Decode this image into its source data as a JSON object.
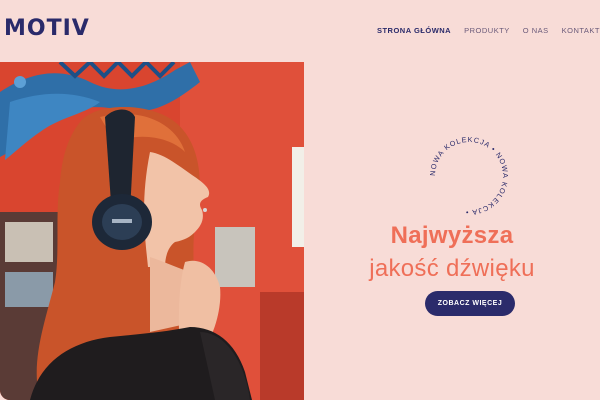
{
  "brand": {
    "logo": "MOTIV"
  },
  "nav": {
    "items": [
      {
        "label": "STRONA GŁÓWNA",
        "active": true
      },
      {
        "label": "PRODUKTY",
        "active": false
      },
      {
        "label": "O NAS",
        "active": false
      },
      {
        "label": "KONTAKT",
        "active": false
      }
    ]
  },
  "hero": {
    "image_icon": "woman-with-headphones-photo",
    "badge_text": "NOWA KOLEKCJA • NOWA KOLEKCJA •",
    "headline_line1": "Najwyższa",
    "headline_line2": "jakość dźwięku",
    "cta_label": "ZOBACZ WIĘCEJ"
  },
  "colors": {
    "background": "#f8dcd7",
    "brand_navy": "#2a2a6a",
    "accent_coral": "#ef6f58",
    "button": "#2b2b6b"
  }
}
